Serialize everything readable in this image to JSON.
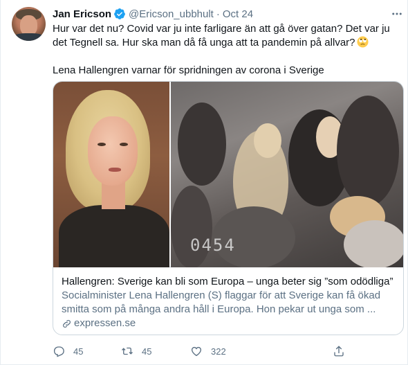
{
  "author": {
    "name": "Jan Ericson",
    "handle": "@Ericson_ubbhult",
    "separator": "·",
    "time": "Oct 24",
    "verified": true,
    "verified_color": "#1da1f2"
  },
  "tweet": {
    "line1": "Hur var det nu? Covid var ju inte farligare än att gå över gatan? Det var ju det Tegnell sa. Hur ska man då få unga att ta pandemin på allvar?",
    "emoji": "face-with-rolling-eyes",
    "line2": "Lena Hallengren varnar för spridningen av corona i Sverige"
  },
  "card": {
    "image_stamp": "0454",
    "title": "Hallengren: Sverige kan bli som Europa – unga beter sig ”som odödliga”",
    "description": "Socialminister Lena Hallengren (S) flaggar för att Sverige kan få ökad smitta som på många andra håll i Europa. Hon pekar ut unga som ...",
    "domain": "expressen.se",
    "link_icon": "link-icon"
  },
  "actions": {
    "reply_count": "45",
    "retweet_count": "45",
    "like_count": "322",
    "reply_icon": "reply-icon",
    "retweet_icon": "retweet-icon",
    "like_icon": "heart-icon",
    "share_icon": "share-icon"
  },
  "colors": {
    "text": "#0f1419",
    "secondary": "#5b7083",
    "border": "#ccd6dd",
    "accent": "#1da1f2"
  }
}
